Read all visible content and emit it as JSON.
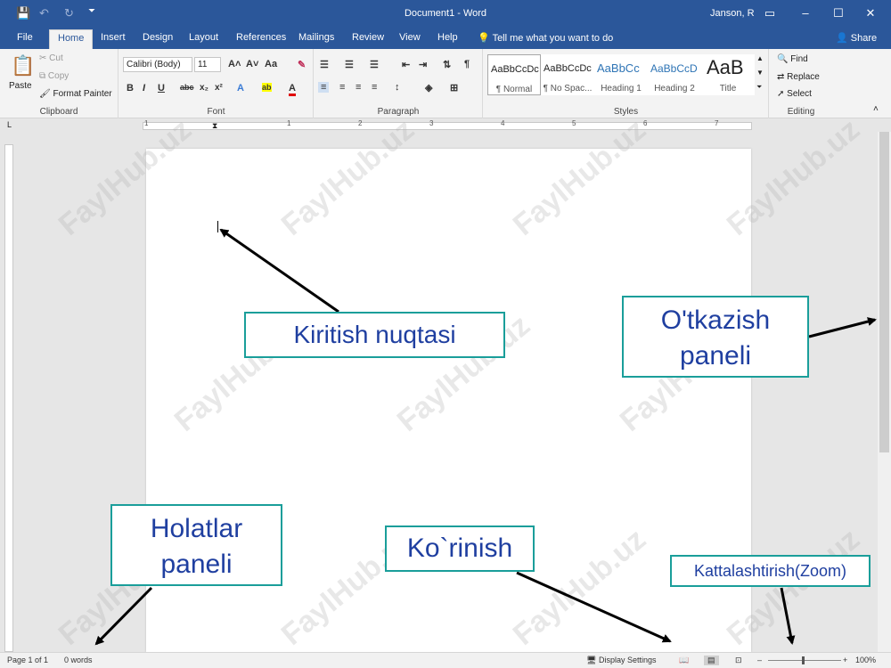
{
  "window": {
    "title": "Document1 - Word",
    "user": "Janson, R",
    "accent": "#2b579a"
  },
  "quick_access": {
    "save_icon": "save-icon",
    "undo_icon": "undo-icon",
    "redo_icon": "redo-icon",
    "customize_icon": "customize-icon"
  },
  "tabs": [
    {
      "label": "File"
    },
    {
      "label": "Home"
    },
    {
      "label": "Insert"
    },
    {
      "label": "Design"
    },
    {
      "label": "Layout"
    },
    {
      "label": "References"
    },
    {
      "label": "Mailings"
    },
    {
      "label": "Review"
    },
    {
      "label": "View"
    },
    {
      "label": "Help"
    }
  ],
  "tell_me": "Tell me what you want to do",
  "share": "Share",
  "ribbon": {
    "clipboard": {
      "label": "Clipboard",
      "paste": "Paste",
      "cut": "Cut",
      "copy": "Copy",
      "format_painter": "Format Painter"
    },
    "font": {
      "label": "Font",
      "font_name": "Calibri (Body)",
      "font_size": "11"
    },
    "paragraph": {
      "label": "Paragraph"
    },
    "styles": {
      "label": "Styles",
      "items": [
        {
          "sample": "AaBbCcDc",
          "name": "¶ Normal"
        },
        {
          "sample": "AaBbCcDc",
          "name": "¶ No Spac..."
        },
        {
          "sample": "AaBbCc",
          "name": "Heading 1"
        },
        {
          "sample": "AaBbCcD",
          "name": "Heading 2"
        },
        {
          "sample": "AaB",
          "name": "Title"
        }
      ]
    },
    "editing": {
      "label": "Editing",
      "find": "Find",
      "replace": "Replace",
      "select": "Select"
    }
  },
  "ruler_numbers": [
    "1",
    "1",
    "2",
    "3",
    "4",
    "5",
    "6",
    "7"
  ],
  "status": {
    "page": "Page 1 of 1",
    "words": "0 words",
    "display_settings": "Display Settings",
    "zoom": "100%"
  },
  "callouts": {
    "insertion_point": "Kiritish nuqtasi",
    "scroll_panel": "O'tkazish paneli",
    "status_panel": "Holatlar paneli",
    "view": "Ko`rinish",
    "zoom": "Kattalashtirish(Zoom)"
  },
  "watermark": "FaylHub.uz",
  "colors": {
    "callout_border": "#1a9e9a",
    "callout_text": "#1f3fa0"
  }
}
